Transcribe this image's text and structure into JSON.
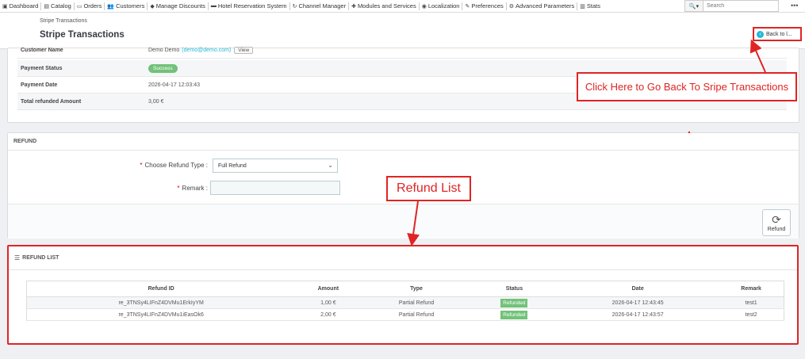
{
  "nav": {
    "items": [
      {
        "label": "Dashboard",
        "icon": "dashboard-icon",
        "glyph": "▣"
      },
      {
        "label": "Catalog",
        "icon": "catalog-icon",
        "glyph": "▤"
      },
      {
        "label": "Orders",
        "icon": "orders-icon",
        "glyph": "▭"
      },
      {
        "label": "Customers",
        "icon": "customers-icon",
        "glyph": "👥"
      },
      {
        "label": "Manage Discounts",
        "icon": "tag-icon",
        "glyph": "◆"
      },
      {
        "label": "Hotel Reservation System",
        "icon": "bed-icon",
        "glyph": "▬"
      },
      {
        "label": "Channel Manager",
        "icon": "refresh-icon",
        "glyph": "↻"
      },
      {
        "label": "Modules and Services",
        "icon": "puzzle-icon",
        "glyph": "✚"
      },
      {
        "label": "Localization",
        "icon": "globe-icon",
        "glyph": "◉"
      },
      {
        "label": "Preferences",
        "icon": "wrench-icon",
        "glyph": "✎"
      },
      {
        "label": "Advanced Parameters",
        "icon": "cogs-icon",
        "glyph": "⚙"
      },
      {
        "label": "Stats",
        "icon": "bar-chart-icon",
        "glyph": "▥"
      }
    ],
    "search_placeholder": "Search",
    "more": "•••"
  },
  "header": {
    "breadcrumb": "Stripe Transactions",
    "title": "Stripe Transactions",
    "back_label": "Back to l..."
  },
  "transaction": {
    "customer_label": "Customer Name",
    "customer_value": "Demo Demo",
    "customer_email": "(demo@demo.com)",
    "view_label": "View",
    "status_label": "Payment Status",
    "status_value": "Success",
    "date_label": "Payment Date",
    "date_value": "2026-04-17 12:03:43",
    "refunded_label": "Total refunded Amount",
    "refunded_value": "3,00 €"
  },
  "refund_form": {
    "heading": "REFUND",
    "type_label": "Choose Refund Type :",
    "type_value": "Full Refund",
    "remark_label": "Remark :",
    "submit_label": "Refund"
  },
  "refund_list": {
    "heading": "REFUND LIST",
    "columns": [
      "Refund ID",
      "Amount",
      "Type",
      "Status",
      "Date",
      "Remark"
    ],
    "rows": [
      [
        "re_3TNSy4LIFnZ4DVMu1ErkIyYM",
        "1,00 €",
        "Partial Refund",
        "Refunded",
        "2026-04-17 12:43:45",
        "test1"
      ],
      [
        "re_3TNSy4LIFnZ4DVMu1iEasOk6",
        "2,00 €",
        "Partial Refund",
        "Refunded",
        "2026-04-17 12:43:57",
        "test2"
      ]
    ]
  },
  "annotations": {
    "back_note": "Click Here to Go Back To Sripe Transactions",
    "list_note": "Refund List"
  },
  "colors": {
    "accent": "#25b9d7",
    "success": "#72c279",
    "annotation": "#e02424"
  }
}
